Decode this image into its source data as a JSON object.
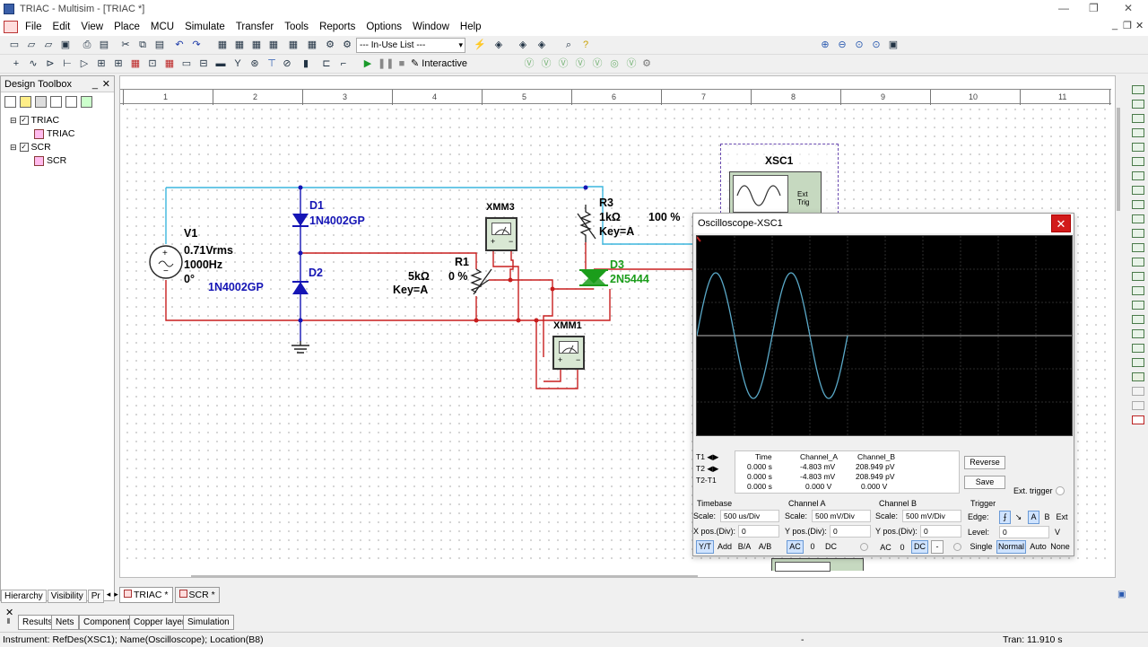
{
  "app": {
    "title": "TRIAC - Multisim - [TRIAC *]"
  },
  "menu": [
    "File",
    "Edit",
    "View",
    "Place",
    "MCU",
    "Simulate",
    "Transfer",
    "Tools",
    "Reports",
    "Options",
    "Window",
    "Help"
  ],
  "toolbar": {
    "in_use_list": "--- In-Use List ---",
    "interactive_label": "Interactive"
  },
  "toolbox": {
    "title": "Design Toolbox",
    "tree": [
      {
        "label": "TRIAC",
        "child": "TRIAC"
      },
      {
        "label": "SCR",
        "child": "SCR"
      }
    ],
    "tabs": [
      "Hierarchy",
      "Visibility",
      "Pr"
    ]
  },
  "ruler": [
    "1",
    "2",
    "3",
    "4",
    "5",
    "6",
    "7",
    "8",
    "9",
    "10",
    "11"
  ],
  "schematic": {
    "v1": {
      "ref": "V1",
      "value": "0.71Vrms",
      "freq": "1000Hz",
      "phase": "0°"
    },
    "d1": {
      "ref": "D1",
      "part": "1N4002GP"
    },
    "d2": {
      "ref": "D2",
      "part": "1N4002GP"
    },
    "r1": {
      "ref": "R1",
      "value": "5kΩ",
      "percent": "0 %",
      "key": "Key=A"
    },
    "r3": {
      "ref": "R3",
      "value": "1kΩ",
      "percent": "100 %",
      "key": "Key=A"
    },
    "d3": {
      "ref": "D3",
      "part": "2N5444"
    },
    "xmm3": "XMM3",
    "xmm1": "XMM1",
    "xsc1": {
      "ref": "XSC1",
      "ext_trig": "Ext Trig"
    }
  },
  "oscilloscope": {
    "title": "Oscilloscope-XSC1",
    "readout": {
      "headers": [
        "Time",
        "Channel_A",
        "Channel_B"
      ],
      "rows": [
        {
          "label": "T1",
          "time": "0.000 s",
          "a": "-4.803 mV",
          "b": "208.949 pV"
        },
        {
          "label": "T2",
          "time": "0.000 s",
          "a": "-4.803 mV",
          "b": "208.949 pV"
        },
        {
          "label": "T2-T1",
          "time": "0.000 s",
          "a": "0.000 V",
          "b": "0.000 V"
        }
      ]
    },
    "buttons": {
      "reverse": "Reverse",
      "save": "Save",
      "ext_trigger": "Ext. trigger"
    },
    "timebase": {
      "title": "Timebase",
      "scale_label": "Scale:",
      "scale": "500 us/Div",
      "xpos_label": "X pos.(Div):",
      "xpos": "0",
      "modes": [
        "Y/T",
        "Add",
        "B/A",
        "A/B"
      ]
    },
    "channel_a": {
      "title": "Channel A",
      "scale_label": "Scale:",
      "scale": "500 mV/Div",
      "ypos_label": "Y pos.(Div):",
      "ypos": "0",
      "coupling": [
        "AC",
        "0",
        "DC"
      ]
    },
    "channel_b": {
      "title": "Channel B",
      "scale_label": "Scale:",
      "scale": "500 mV/Div",
      "ypos_label": "Y pos.(Div):",
      "ypos": "0",
      "coupling": [
        "AC",
        "0",
        "DC",
        "-"
      ]
    },
    "trigger": {
      "title": "Trigger",
      "edge_label": "Edge:",
      "level_label": "Level:",
      "level": "0",
      "level_unit": "V",
      "sources": [
        "A",
        "B",
        "Ext"
      ],
      "modes": [
        "Single",
        "Normal",
        "Auto",
        "None"
      ]
    }
  },
  "doc_tabs": [
    "TRIAC *",
    "SCR *"
  ],
  "spreadsheet_tabs": [
    "Results",
    "Nets",
    "Components",
    "Copper layers",
    "Simulation"
  ],
  "status": {
    "left": "Instrument: RefDes(XSC1); Name(Oscilloscope); Location(B8)",
    "mid": "-",
    "right": "Tran: 11.910 s"
  },
  "colors": {
    "wire_red": "#c81e1e",
    "wire_cyan": "#3cb6de",
    "diode_blue": "#1515b5",
    "scr_green": "#1b9d1b",
    "trace": "#5aa9c8"
  }
}
